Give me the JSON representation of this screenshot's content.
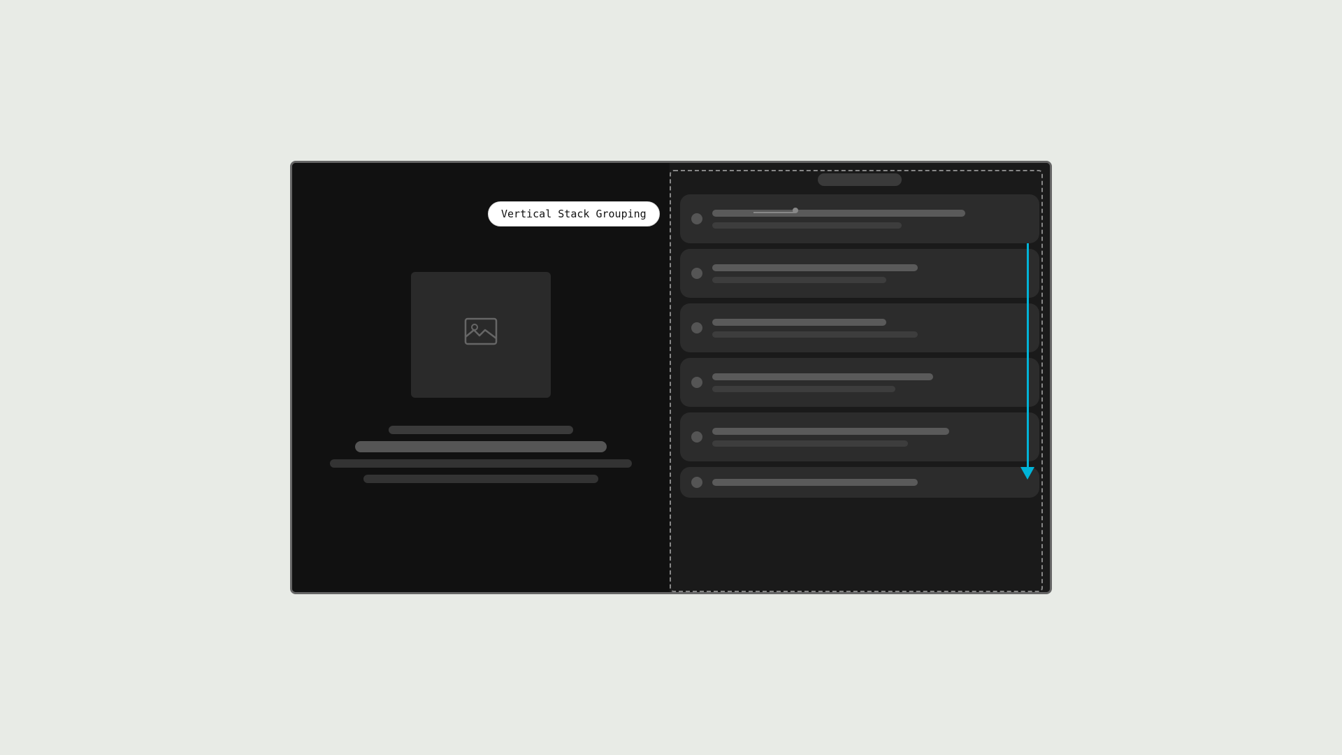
{
  "tooltip": {
    "label": "Vertical Stack Grouping"
  },
  "left_panel": {
    "bars": [
      {
        "id": "bar-short",
        "class": "bar bar-short"
      },
      {
        "id": "bar-medium",
        "class": "bar bar-medium"
      },
      {
        "id": "bar-long",
        "class": "bar bar-long"
      },
      {
        "id": "bar-medium2",
        "class": "bar bar-medium2"
      }
    ]
  },
  "right_panel": {
    "items": [
      {
        "top_width": "w80",
        "bottom_width": "w60"
      },
      {
        "top_width": "w65",
        "bottom_width": "w55"
      },
      {
        "top_width": "w55",
        "bottom_width": "w65"
      },
      {
        "top_width": "w70",
        "bottom_width": "w58"
      },
      {
        "top_width": "w75",
        "bottom_width": "w62"
      }
    ]
  },
  "arrow": {
    "color": "#00b4d8",
    "direction": "down"
  }
}
